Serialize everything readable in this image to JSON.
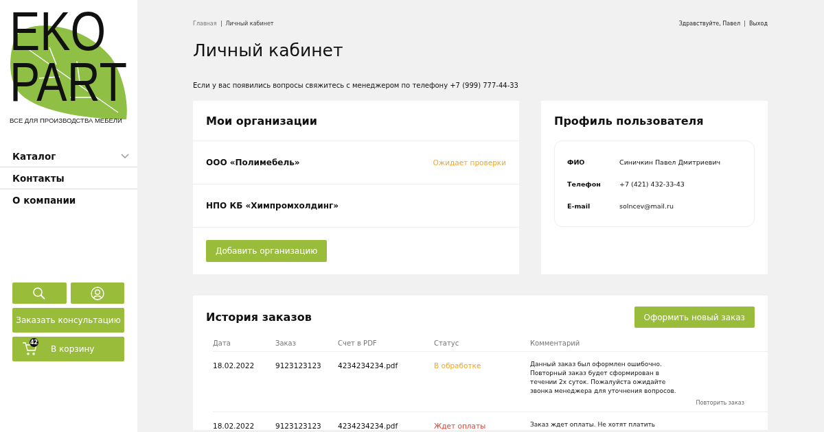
{
  "logo": {
    "line_1": "EKO",
    "line_2": "PART",
    "tagline": "ВСЕ ДЛЯ ПРОИЗВОДСТВА МЕБЕЛИ"
  },
  "nav": [
    {
      "label": "Каталог",
      "has_submenu": true
    },
    {
      "label": "Контакты",
      "has_submenu": false
    },
    {
      "label": "О компании",
      "has_submenu": false
    }
  ],
  "sidebar_buttons": {
    "consult": "Заказать консультацию",
    "cart": "В корзину",
    "cart_count": "42"
  },
  "breadcrumbs": [
    "Главная",
    "Личный кабинет"
  ],
  "user_bar": {
    "greeting": "Здравствуйте, Павел",
    "logout": "Выход"
  },
  "title": "Личный кабинет",
  "notice": "Если у вас появились вопросы свяжитесь с менеджером по телефону +7 (999) 777-44-33",
  "organizations": {
    "title": "Мои организации",
    "items": [
      {
        "name": "ООО «Полимебель»",
        "status": "Ожидает проверки",
        "color": "#f5a623"
      },
      {
        "name": "НПО КБ «Химпромхолдинг»"
      }
    ],
    "add_button": "Добавить организацию"
  },
  "profile": {
    "title": "Профиль пользователя",
    "fields": [
      {
        "label": "ФИО",
        "value": "Синичкин Павел Дмитриевич"
      },
      {
        "label": "Телефон",
        "value": "+7 (421) 432-33-43"
      },
      {
        "label": "E-mail",
        "value": "solncev@mail.ru"
      }
    ]
  },
  "orders": {
    "title": "История заказов",
    "new_button": "Оформить новый заказ",
    "columns": [
      "Дата",
      "Заказ",
      "Счет в PDF",
      "Статус",
      "Комментарий"
    ],
    "rows": [
      {
        "date": "18.02.2022",
        "order": "9123123123",
        "invoice": "4234234234.pdf",
        "status": "В обработке",
        "color": "#f5a623",
        "comment": "Данный заказ был оформлен ошибочно. Повторный заказ будет сформирован в течении 2х суток. Пожалуйста ожидайте звонка менеджера для уточнения вопросов.",
        "repeat": "Повторить заказ"
      },
      {
        "date": "18.02.2022",
        "order": "9123123123",
        "invoice": "4234234234.pdf",
        "status": "Ждет оплаты",
        "color": "#e8422f",
        "comment": "Заказ ждет оплаты. Не хотят платить"
      }
    ]
  }
}
